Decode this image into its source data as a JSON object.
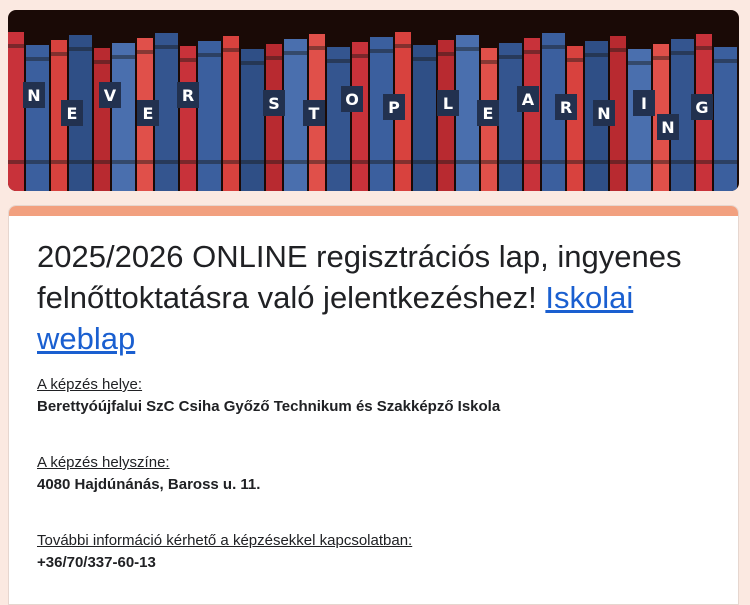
{
  "header": {
    "image_alt": "NEVER STOP LEARNING",
    "banner_letters": [
      "N",
      "E",
      "V",
      "E",
      "R",
      "S",
      "T",
      "O",
      "P",
      "L",
      "E",
      "A",
      "R",
      "N",
      "I",
      "N",
      "G"
    ]
  },
  "form": {
    "title_text": "2025/2026 ONLINE regisztrációs lap, ingyenes felnőttoktatásra való jelentkezéshez!",
    "title_link": "Iskolai weblap",
    "info": [
      {
        "label": "A képzés helye:",
        "value": "Berettyóújfalui SzC Csiha Győző Technikum és Szakképző Iskola"
      },
      {
        "label": "A képzés helyszíne:",
        "value": "4080 Hajdúnánás, Baross u. 11."
      },
      {
        "label": "További információ kérhető a képzésekkel kapcsolatban:",
        "value": "+36/70/337-60-13"
      }
    ]
  },
  "colors": {
    "background": "#fbe9e1",
    "accent": "#f2a07f",
    "link": "#1a5fd0"
  }
}
